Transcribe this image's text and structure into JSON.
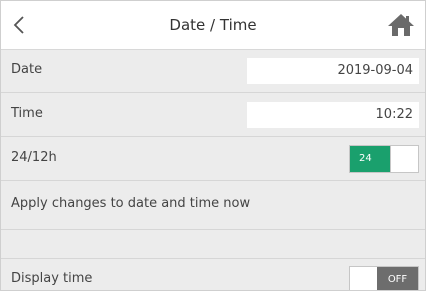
{
  "header": {
    "title": "Date / Time",
    "back_icon": "chevron-left-icon",
    "home_icon": "home-icon"
  },
  "rows": {
    "date": {
      "label": "Date",
      "value": "2019-09-04"
    },
    "time": {
      "label": "Time",
      "value": "10:22"
    },
    "format": {
      "label": "24/12h",
      "toggle_label": "24",
      "state": "on"
    },
    "apply": {
      "label": "Apply changes to date and time now"
    },
    "display_time": {
      "label": "Display time",
      "toggle_label": "OFF",
      "state": "off"
    }
  },
  "colors": {
    "toggle_on": "#1aa06d",
    "toggle_off": "#6d6d6d",
    "background": "#ececec",
    "header": "#ffffff"
  }
}
